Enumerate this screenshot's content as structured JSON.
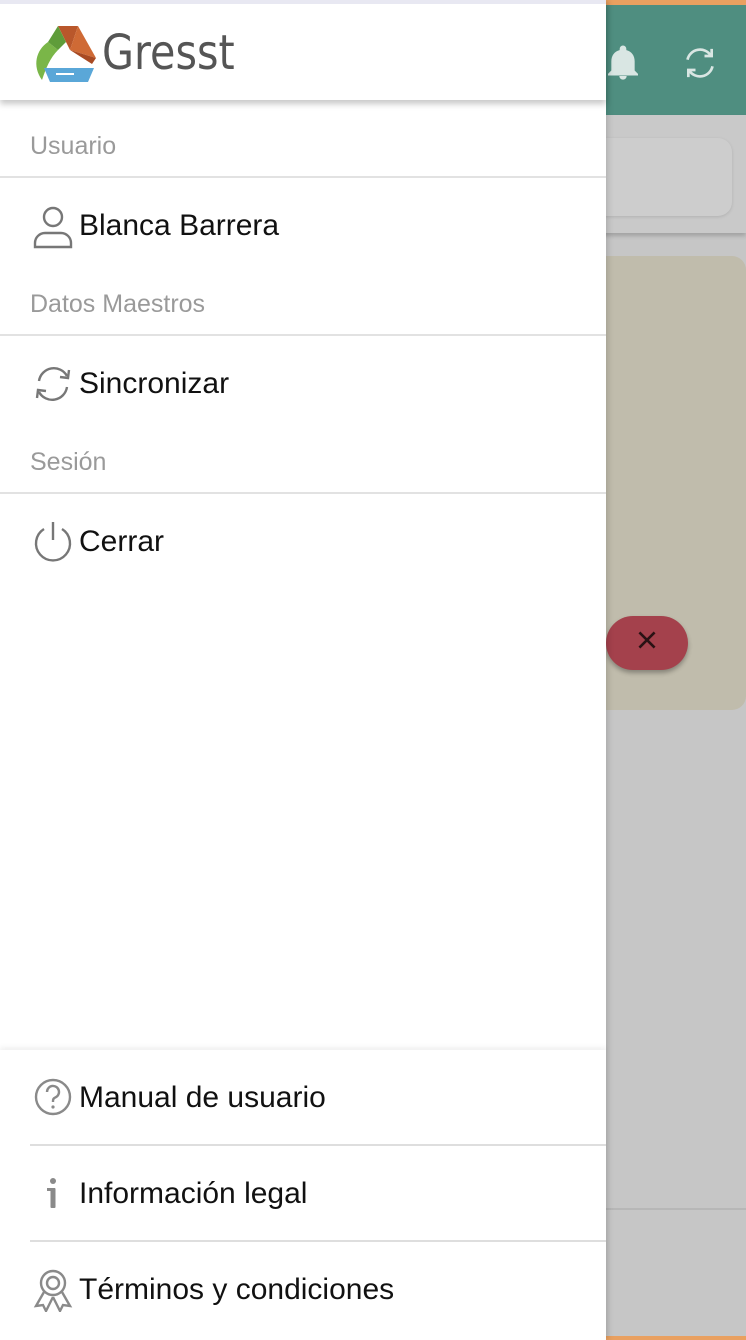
{
  "app": {
    "brand": "Gresst"
  },
  "drawer": {
    "sections": [
      {
        "title": "Usuario",
        "item": {
          "label": "Blanca Barrera",
          "icon": "user-icon"
        }
      },
      {
        "title": "Datos Maestros",
        "item": {
          "label": "Sincronizar",
          "icon": "sync-icon"
        }
      },
      {
        "title": "Sesión",
        "item": {
          "label": "Cerrar",
          "icon": "power-icon"
        }
      }
    ],
    "footer": [
      {
        "label": "Manual de usuario",
        "icon": "help-circle-icon"
      },
      {
        "label": "Información legal",
        "icon": "info-icon"
      },
      {
        "label": "Términos y condiciones",
        "icon": "award-icon"
      }
    ]
  },
  "background": {
    "header_icons": [
      "bell-icon",
      "sync-icon"
    ],
    "fab_icon": "close-icon"
  },
  "colors": {
    "header": "#4f8e80",
    "accent": "#e9a060",
    "fab": "#a4414c",
    "card": "#c0bcac"
  }
}
